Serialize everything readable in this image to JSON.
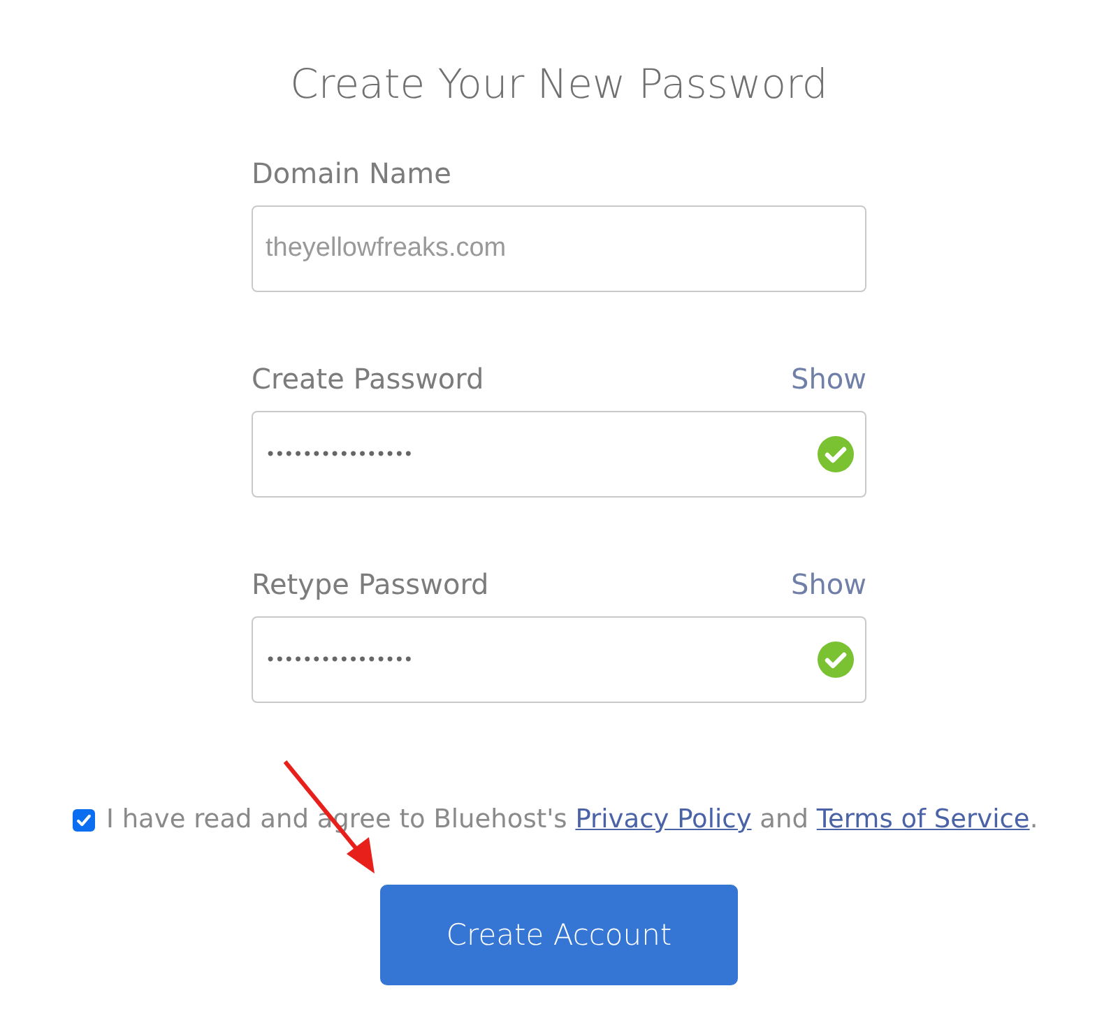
{
  "title": "Create Your New Password",
  "fields": [
    {
      "kind": "text",
      "label": "Domain Name",
      "value": "theyellowfreaks.com"
    },
    {
      "kind": "password",
      "label": "Create Password",
      "toggle": "Show",
      "value": "••••••••••••••••",
      "valid": true
    },
    {
      "kind": "password",
      "label": "Retype Password",
      "toggle": "Show",
      "value": "••••••••••••••••",
      "valid": true
    }
  ],
  "agreement": {
    "checked": true,
    "parts": [
      {
        "kind": "text",
        "text": "I have read and agree to Bluehost's "
      },
      {
        "kind": "link",
        "text": "Privacy Policy"
      },
      {
        "kind": "text",
        "text": " and "
      },
      {
        "kind": "link",
        "text": "Terms of Service"
      },
      {
        "kind": "text",
        "text": "."
      }
    ]
  },
  "button": "Create Account"
}
